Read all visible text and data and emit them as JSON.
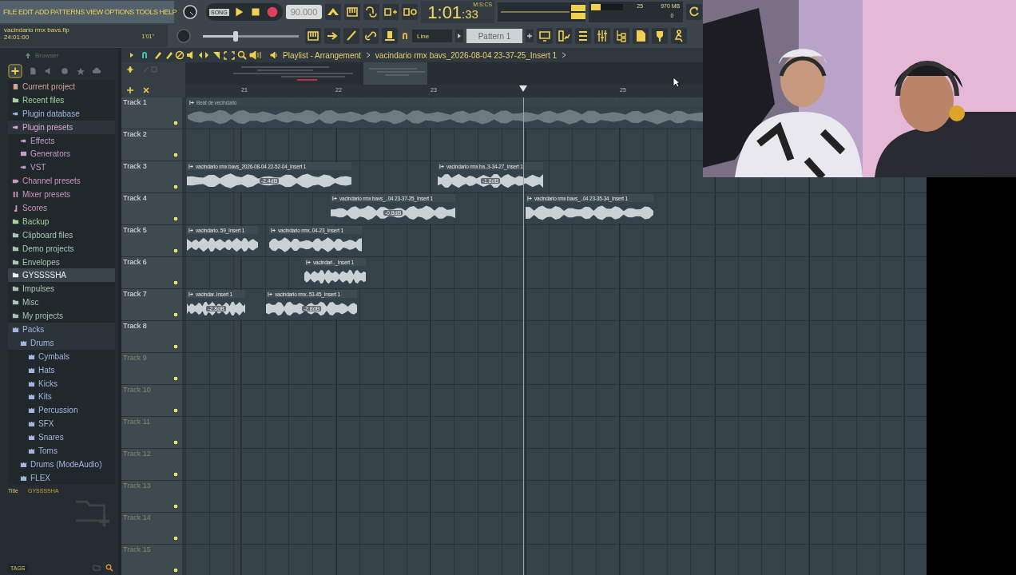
{
  "menu": [
    "FILE",
    "EDIT",
    "ADD",
    "PATTERNS",
    "VIEW",
    "OPTIONS",
    "TOOLS",
    "HELP"
  ],
  "project": {
    "name": "vacindario rmx bavs.flp",
    "position": "24:01:00",
    "length": "1'01\""
  },
  "transport": {
    "mode": "SONG",
    "tempo": "90.000",
    "time": "1:01",
    "time_sub": ":33",
    "time_unit": "M:S:CS"
  },
  "master_slider": {
    "level": 0.34
  },
  "cpu": {
    "level": 0.3,
    "value": "25",
    "memory": "970 MB",
    "polyphony": "0"
  },
  "snap": "Line",
  "pattern": "Pattern 1",
  "browser": {
    "title": "Browser",
    "items": [
      {
        "label": "Current project",
        "kind": "project",
        "color": "#d4a49c",
        "selected": false
      },
      {
        "label": "Recent files",
        "kind": "recent",
        "color": "#a5d19a",
        "selected": false
      },
      {
        "label": "Plugin database",
        "kind": "plugin",
        "color": "#a4b6e0",
        "selected": false
      },
      {
        "label": "Plugin presets",
        "kind": "plugin",
        "color": "#d9a6d9",
        "selected": false,
        "expanded": true,
        "children": [
          {
            "label": "Effects",
            "kind": "effect",
            "color": "#c79ac7",
            "selected": false
          },
          {
            "label": "Generators",
            "kind": "generator",
            "color": "#c79ac7",
            "selected": false
          },
          {
            "label": "VST",
            "kind": "plugin",
            "color": "#c79ac7",
            "selected": false
          }
        ]
      },
      {
        "label": "Channel presets",
        "kind": "channel",
        "color": "#cf95b8",
        "selected": false
      },
      {
        "label": "Mixer presets",
        "kind": "mixer",
        "color": "#cf95b8",
        "selected": false
      },
      {
        "label": "Scores",
        "kind": "note",
        "color": "#cf95b8",
        "selected": false
      },
      {
        "label": "Backup",
        "kind": "recent",
        "color": "#a5d19a",
        "selected": false
      },
      {
        "label": "Clipboard files",
        "kind": "folder",
        "color": "#a9c4b4",
        "selected": false
      },
      {
        "label": "Demo projects",
        "kind": "folder",
        "color": "#a9c4b4",
        "selected": false
      },
      {
        "label": "Envelopes",
        "kind": "folder",
        "color": "#a9c4b4",
        "selected": false
      },
      {
        "label": "GYSSSSHA",
        "kind": "folder",
        "color": "#e8eef0",
        "selected": true
      },
      {
        "label": "Impulses",
        "kind": "folder",
        "color": "#a9c4b4",
        "selected": false
      },
      {
        "label": "Misc",
        "kind": "folder",
        "color": "#a9c4b4",
        "selected": false
      },
      {
        "label": "My projects",
        "kind": "folder",
        "color": "#a9c4b4",
        "selected": false
      },
      {
        "label": "Packs",
        "kind": "pack",
        "color": "#a4b6e0",
        "selected": false,
        "expanded": true,
        "children": [
          {
            "label": "Drums",
            "kind": "pack",
            "color": "#a4b6e0",
            "selected": false,
            "expanded": true,
            "children": [
              {
                "label": "Cymbals",
                "kind": "pack",
                "color": "#a4b6e0",
                "selected": false
              },
              {
                "label": "Hats",
                "kind": "pack",
                "color": "#a4b6e0",
                "selected": false
              },
              {
                "label": "Kicks",
                "kind": "pack",
                "color": "#a4b6e0",
                "selected": false
              },
              {
                "label": "Kits",
                "kind": "pack",
                "color": "#a4b6e0",
                "selected": false
              },
              {
                "label": "Percussion",
                "kind": "pack",
                "color": "#a4b6e0",
                "selected": false
              },
              {
                "label": "SFX",
                "kind": "pack",
                "color": "#a4b6e0",
                "selected": false
              },
              {
                "label": "Snares",
                "kind": "pack",
                "color": "#a4b6e0",
                "selected": false
              },
              {
                "label": "Toms",
                "kind": "pack",
                "color": "#a4b6e0",
                "selected": false
              }
            ]
          },
          {
            "label": "Drums (ModeAudio)",
            "kind": "pack",
            "color": "#a4b6e0",
            "selected": false
          },
          {
            "label": "FLEX",
            "kind": "pack",
            "color": "#a4b6e0",
            "selected": false
          }
        ]
      }
    ],
    "info": {
      "title_label": "Title",
      "title_value": "GYSSSSHA"
    },
    "tags_button": "TAGS"
  },
  "playlist": {
    "title": "Playlist - Arrangement",
    "clip_name": "vacindario rmx bavs_2026-08-04 23-37-25_Insert 1",
    "ruler": [
      "21",
      "22",
      "23",
      "25"
    ],
    "tracks": [
      {
        "name": "Track 1",
        "dimmed": false,
        "clips": [
          {
            "name": "Beat de vecindario",
            "muted": true
          }
        ]
      },
      {
        "name": "Track 2",
        "dimmed": false
      },
      {
        "name": "Track 3",
        "dimmed": false,
        "clips": [
          {
            "name": "vacindario rmx bavs_2026-08-04 22-52-04_Insert 1",
            "gain": "-2.4dB",
            "muted": false
          },
          {
            "name": "vacindario rmx ba..3-34-27_Insert 1",
            "gain": "-1.8dB",
            "muted": false
          }
        ]
      },
      {
        "name": "Track 4",
        "dimmed": false,
        "clips": [
          {
            "name": "vacindario rmx bavs_..04 23-37-25_Insert 1",
            "gain": "-0.8dB",
            "muted": false
          },
          {
            "name": "vacindario rmx bavs_..04 23-35-34_Insert 1",
            "muted": false
          }
        ]
      },
      {
        "name": "Track 5",
        "dimmed": false,
        "clips": [
          {
            "name": "vacindario..59_Insert 1",
            "muted": false
          },
          {
            "name": "vacindario rmx..04-23_Insert 1",
            "muted": false
          }
        ]
      },
      {
        "name": "Track 6",
        "dimmed": false,
        "clips": [
          {
            "name": "vacindari.._Insert 1",
            "muted": false
          }
        ]
      },
      {
        "name": "Track 7",
        "dimmed": false,
        "clips": [
          {
            "name": "vacindar..Insert 1",
            "gain": "-2.8dB",
            "muted": false
          },
          {
            "name": "vacindario rmx..53-45_Insert 1",
            "gain": "-2.8dB",
            "muted": false
          }
        ]
      },
      {
        "name": "Track 8",
        "dimmed": false
      },
      {
        "name": "Track 9",
        "dimmed": true
      },
      {
        "name": "Track 10",
        "dimmed": true
      },
      {
        "name": "Track 11",
        "dimmed": true
      },
      {
        "name": "Track 12",
        "dimmed": true
      },
      {
        "name": "Track 13",
        "dimmed": true
      },
      {
        "name": "Track 14",
        "dimmed": true
      },
      {
        "name": "Track 15",
        "dimmed": true
      }
    ]
  }
}
